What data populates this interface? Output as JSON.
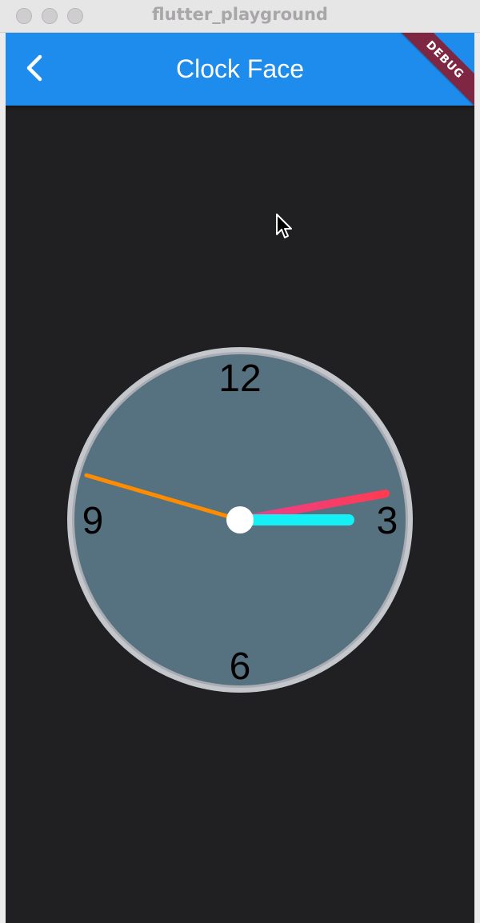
{
  "window": {
    "title": "flutter_playground",
    "controls": [
      "close-button",
      "minimize-button",
      "zoom-button"
    ]
  },
  "appbar": {
    "title": "Clock Face",
    "back_icon": "chevron-left-icon",
    "background": "#1e8cec",
    "debug_banner": "DEBUG"
  },
  "clock": {
    "numerals": {
      "twelve": "12",
      "three": "3",
      "six": "6",
      "nine": "9"
    },
    "time": {
      "hour": 3,
      "minute": 12.5,
      "second": 47.7
    },
    "colors": {
      "face": "#56717f",
      "rim": "#c3c6cb",
      "hour_hand": "#14f0f6",
      "minute_hand_start": "#e8408f",
      "minute_hand_end": "#ff3b52",
      "second_hand": "#ff8c00",
      "center": "#ffffff"
    }
  },
  "background": "#201f21"
}
